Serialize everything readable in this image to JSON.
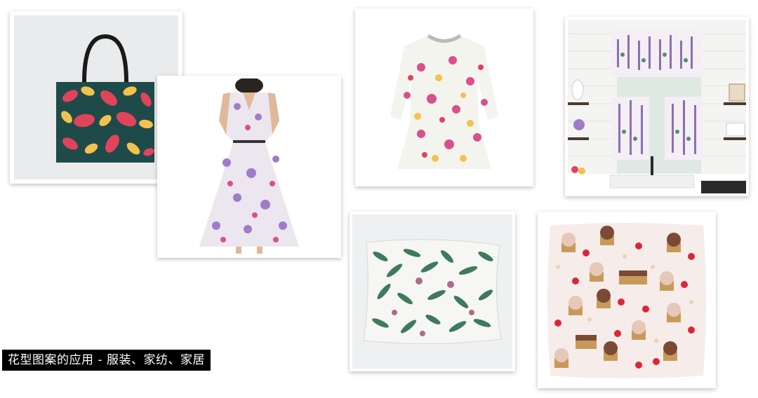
{
  "caption": "花型图案的应用 - 服装、家纺、家居",
  "products": [
    {
      "name": "tote-bag"
    },
    {
      "name": "floral-dress"
    },
    {
      "name": "kids-floral-dress"
    },
    {
      "name": "kitchen-curtains"
    },
    {
      "name": "leaf-pillow"
    },
    {
      "name": "cupcake-pillow"
    }
  ],
  "colors": {
    "tote_bg": "#1f4a4a",
    "leaf_red": "#e0445a",
    "leaf_yellow": "#f2c24e",
    "lilac": "#a07cc8",
    "pink": "#d9508a",
    "leaf_green": "#3f7a5a",
    "cupcake_brown": "#7a4a34",
    "strawberry": "#d8273a"
  },
  "icons": [
    "tote-bag-icon",
    "dress-icon",
    "pillow-icon",
    "curtain-icon"
  ]
}
